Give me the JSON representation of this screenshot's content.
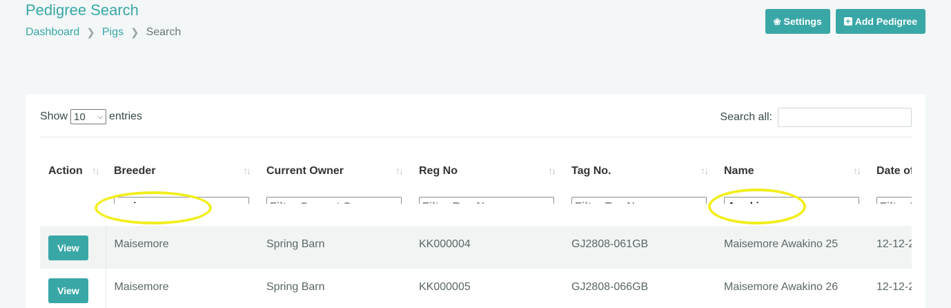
{
  "page": {
    "title": "Pedigree Search"
  },
  "breadcrumb": {
    "items": [
      "Dashboard",
      "Pigs",
      "Search"
    ]
  },
  "actions": {
    "settings_label": "Settings",
    "settings_icon": "gear-icon",
    "add_label": "Add Pedigree",
    "add_icon": "plus-square-icon"
  },
  "table_controls": {
    "show_label": "Show",
    "page_length": "10",
    "entries_label": "entries",
    "search_label": "Search all:",
    "search_value": ""
  },
  "columns": [
    {
      "label": "Action",
      "filter_value": "",
      "filter_placeholder": ""
    },
    {
      "label": "Breeder",
      "filter_value": "maisemore",
      "filter_placeholder": ""
    },
    {
      "label": "Current Owner",
      "filter_value": "",
      "filter_placeholder": "Filter Current Owner"
    },
    {
      "label": "Reg No",
      "filter_value": "",
      "filter_placeholder": "Filter Reg No"
    },
    {
      "label": "Tag No.",
      "filter_value": "",
      "filter_placeholder": "Filter Tag No."
    },
    {
      "label": "Name",
      "filter_value": "Awakino",
      "filter_placeholder": ""
    },
    {
      "label": "Date of",
      "filter_value": "",
      "filter_placeholder": "Filter D"
    }
  ],
  "rows": [
    {
      "action": "View",
      "breeder": "Maisemore",
      "owner": "Spring Barn",
      "reg_no": "KK000004",
      "tag_no": "GJ2808-061GB",
      "name": "Maisemore Awakino 25",
      "date": "12-12-2"
    },
    {
      "action": "View",
      "breeder": "Maisemore",
      "owner": "Spring Barn",
      "reg_no": "KK000005",
      "tag_no": "GJ2808-066GB",
      "name": "Maisemore Awakino 26",
      "date": "12-12-2"
    }
  ],
  "colors": {
    "accent": "#3aa7a7",
    "highlight": "#f2ee1c"
  }
}
